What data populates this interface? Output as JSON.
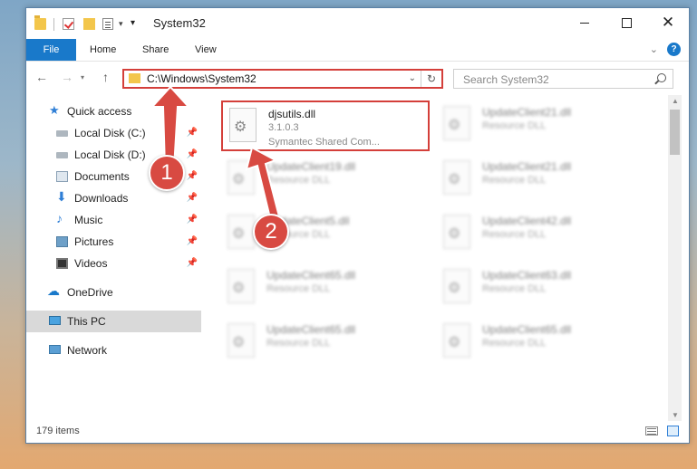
{
  "window": {
    "title": "System32",
    "min_label": "",
    "close_label": "✕"
  },
  "ribbon": {
    "file": "File",
    "home": "Home",
    "share": "Share",
    "view": "View",
    "help": "?"
  },
  "address": {
    "path": "C:\\Windows\\System32",
    "search_placeholder": "Search System32"
  },
  "sidebar": {
    "items": [
      {
        "label": "Quick access"
      },
      {
        "label": "Local Disk (C:)"
      },
      {
        "label": "Local Disk (D:)"
      },
      {
        "label": "Documents"
      },
      {
        "label": "Downloads"
      },
      {
        "label": "Music"
      },
      {
        "label": "Pictures"
      },
      {
        "label": "Videos"
      },
      {
        "label": "OneDrive"
      },
      {
        "label": "This PC"
      },
      {
        "label": "Network"
      }
    ]
  },
  "files": [
    {
      "name": "djsutils.dll",
      "line1": "3.1.0.3",
      "line2": "Symantec Shared Com..."
    },
    {
      "name": "UpdateClient21.dll",
      "line1": "Resource DLL",
      "line2": ""
    },
    {
      "name": "UpdateClient19.dll",
      "line1": "Resource DLL",
      "line2": ""
    },
    {
      "name": "UpdateClient21.dll",
      "line1": "Resource DLL",
      "line2": ""
    },
    {
      "name": "UpdateClient5.dll",
      "line1": "Resource DLL",
      "line2": ""
    },
    {
      "name": "UpdateClient42.dll",
      "line1": "Resource DLL",
      "line2": ""
    },
    {
      "name": "UpdateClient65.dll",
      "line1": "Resource DLL",
      "line2": ""
    },
    {
      "name": "UpdateClient63.dll",
      "line1": "Resource DLL",
      "line2": ""
    },
    {
      "name": "UpdateClient65.dll",
      "line1": "Resource DLL",
      "line2": ""
    },
    {
      "name": "UpdateClient65.dll",
      "line1": "Resource DLL",
      "line2": ""
    }
  ],
  "status": {
    "count": "179 items"
  },
  "annotations": {
    "step1": "1",
    "step2": "2"
  },
  "colors": {
    "accent": "#1979ca",
    "highlight": "#d43f3a",
    "badge": "#d84a42"
  }
}
